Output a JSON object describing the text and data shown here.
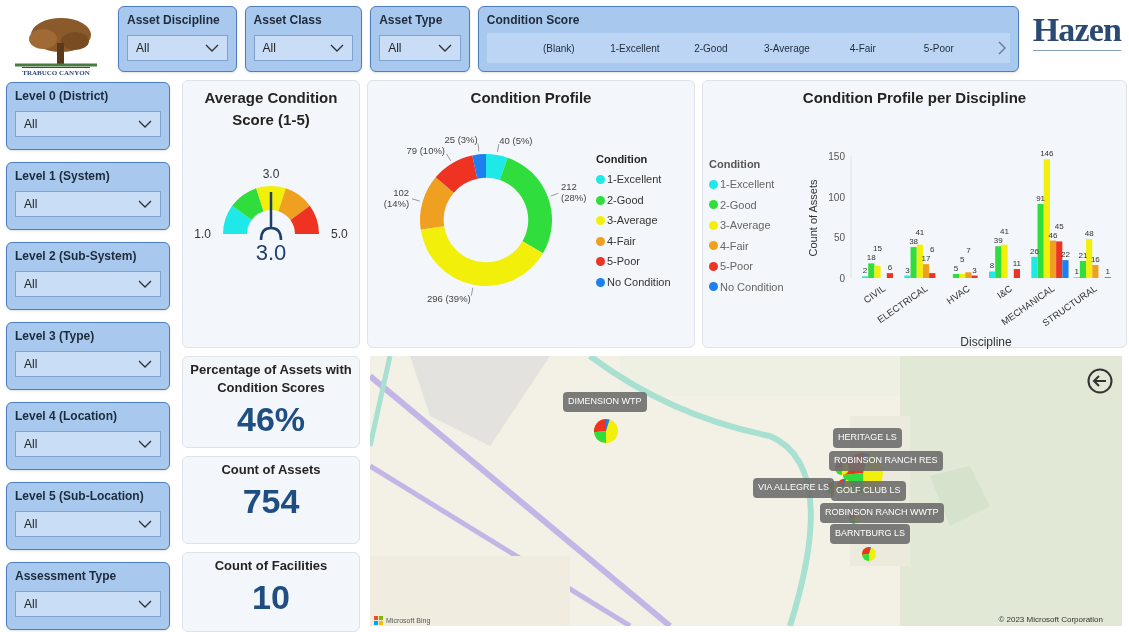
{
  "header": {
    "logo_text": "TRABUCO CANYON",
    "brand": "Hazen"
  },
  "top_slicers": [
    {
      "label": "Asset Discipline",
      "value": "All"
    },
    {
      "label": "Asset Class",
      "value": "All"
    },
    {
      "label": "Asset Type",
      "value": "All"
    }
  ],
  "condition_score": {
    "label": "Condition Score",
    "options": [
      {
        "label": "(Blank)",
        "selected": false
      },
      {
        "label": "1-Excellent",
        "selected": false
      },
      {
        "label": "2-Good",
        "selected": false
      },
      {
        "label": "3-Average",
        "selected": false
      },
      {
        "label": "4-Fair",
        "selected": false
      },
      {
        "label": "5-Poor",
        "selected": false
      }
    ]
  },
  "side_slicers": [
    {
      "label": "Level 0 (District)",
      "value": "All"
    },
    {
      "label": "Level 1 (System)",
      "value": "All"
    },
    {
      "label": "Level 2 (Sub-System)",
      "value": "All"
    },
    {
      "label": "Level 3 (Type)",
      "value": "All"
    },
    {
      "label": "Level 4 (Location)",
      "value": "All"
    },
    {
      "label": "Level 5 (Sub-Location)",
      "value": "All"
    },
    {
      "label": "Assessment Type",
      "value": "All"
    }
  ],
  "gauge_card": {
    "title": "Average Condition Score (1-5)",
    "min": "1.0",
    "max": "5.0",
    "target": "3.0",
    "value": "3.0"
  },
  "kpis": [
    {
      "title": "Percentage of Assets with Condition Scores",
      "value": "46%"
    },
    {
      "title": "Count of Assets",
      "value": "754"
    },
    {
      "title": "Count of Facilities",
      "value": "10"
    }
  ],
  "condition_profile": {
    "title": "Condition Profile",
    "legend_title": "Condition",
    "chart_data": {
      "type": "donut",
      "categories": [
        "1-Excellent",
        "2-Good",
        "3-Average",
        "4-Fair",
        "5-Poor",
        "No Condition"
      ],
      "values": [
        40,
        212,
        296,
        102,
        79,
        25
      ],
      "colors": [
        "#1ee8e8",
        "#2fdd3c",
        "#f2ef0a",
        "#f0a020",
        "#ee3322",
        "#1e7ff0"
      ],
      "value_labels": [
        "40 (5%)",
        "212 (28%)",
        "296 (39%)",
        "102 (14%)",
        "79 (10%)",
        "25 (3%)"
      ]
    }
  },
  "discipline_profile": {
    "title": "Condition Profile per Discipline",
    "legend_title": "Condition",
    "chart_data": {
      "type": "bar",
      "xlabel": "Discipline",
      "ylabel": "Count of Assets",
      "categories": [
        "CIVIL",
        "ELECTRICAL",
        "HVAC",
        "I&C",
        "MECHANICAL",
        "STRUCTURAL"
      ],
      "ylim": [
        0,
        150
      ],
      "yticks": [
        0,
        50,
        100,
        150
      ],
      "data_labels": true,
      "series": [
        {
          "name": "1-Excellent",
          "color": "#1ee8e8",
          "values": [
            2,
            3,
            null,
            8,
            26,
            1
          ]
        },
        {
          "name": "2-Good",
          "color": "#2fdd3c",
          "values": [
            18,
            38,
            5,
            39,
            91,
            21
          ]
        },
        {
          "name": "3-Average",
          "color": "#f2ef0a",
          "values": [
            15,
            41,
            5,
            41,
            146,
            48
          ]
        },
        {
          "name": "4-Fair",
          "color": "#f0a020",
          "values": [
            null,
            17,
            7,
            null,
            46,
            16
          ]
        },
        {
          "name": "5-Poor",
          "color": "#ee3322",
          "values": [
            6,
            6,
            3,
            11,
            45,
            null
          ]
        },
        {
          "name": "No Condition",
          "color": "#1e7ff0",
          "values": [
            null,
            null,
            null,
            null,
            22,
            1
          ]
        }
      ]
    }
  },
  "map": {
    "markers": [
      {
        "label": "DIMENSION WTP"
      },
      {
        "label": "HERITAGE LS"
      },
      {
        "label": "ROBINSON RANCH RES"
      },
      {
        "label": "VIA ALLEGRE LS"
      },
      {
        "label": "GOLF CLUB LS"
      },
      {
        "label": "ROBINSON RANCH WWTP"
      },
      {
        "label": "BARNTBURG LS"
      }
    ],
    "attribution": "Microsoft Bing",
    "copyright": "© 2023 Microsoft Corporation"
  }
}
